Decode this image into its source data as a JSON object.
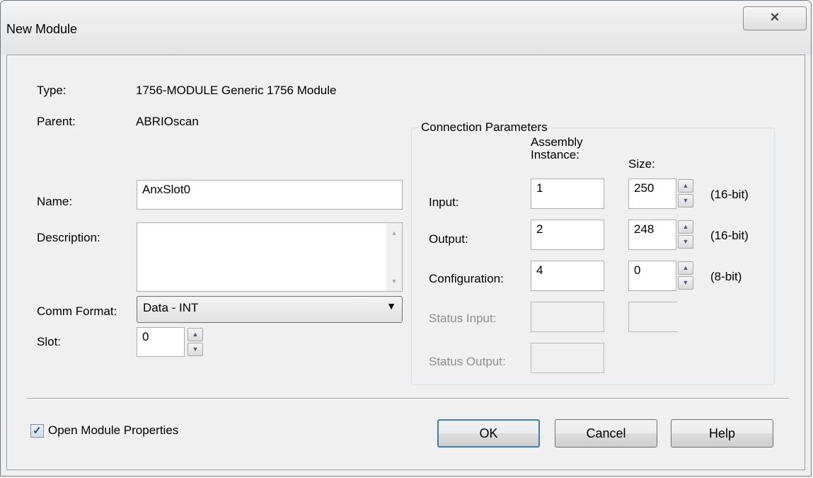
{
  "window": {
    "title": "New Module",
    "close_glyph": "✕"
  },
  "info": {
    "type_label": "Type:",
    "type_value": "1756-MODULE Generic 1756 Module",
    "parent_label": "Parent:",
    "parent_value": "ABRIOscan"
  },
  "form": {
    "name_label": "Name:",
    "name_value": "AnxSlot0",
    "description_label": "Description:",
    "description_value": "",
    "comm_format_label": "Comm Format:",
    "comm_format_value": "Data - INT",
    "slot_label": "Slot:",
    "slot_value": "0"
  },
  "connection": {
    "group_title": "Connection Parameters",
    "assembly_header_line1": "Assembly",
    "assembly_header_line2": "Instance:",
    "size_header": "Size:",
    "rows": [
      {
        "label": "Input:",
        "instance": "1",
        "size": "250",
        "units": "(16-bit)"
      },
      {
        "label": "Output:",
        "instance": "2",
        "size": "248",
        "units": "(16-bit)"
      },
      {
        "label": "Configuration:",
        "instance": "4",
        "size": "0",
        "units": "(8-bit)"
      }
    ],
    "status_input_label": "Status Input:",
    "status_output_label": "Status Output:"
  },
  "footer": {
    "open_props_label": "Open Module Properties",
    "open_props_checked": true,
    "ok_label": "OK",
    "cancel_label": "Cancel",
    "help_label": "Help"
  },
  "icons": [
    "close-icon",
    "spin-up-icon",
    "spin-down-icon",
    "dropdown-arrow-icon",
    "scroll-up-icon",
    "scroll-down-icon",
    "checkmark-icon"
  ]
}
